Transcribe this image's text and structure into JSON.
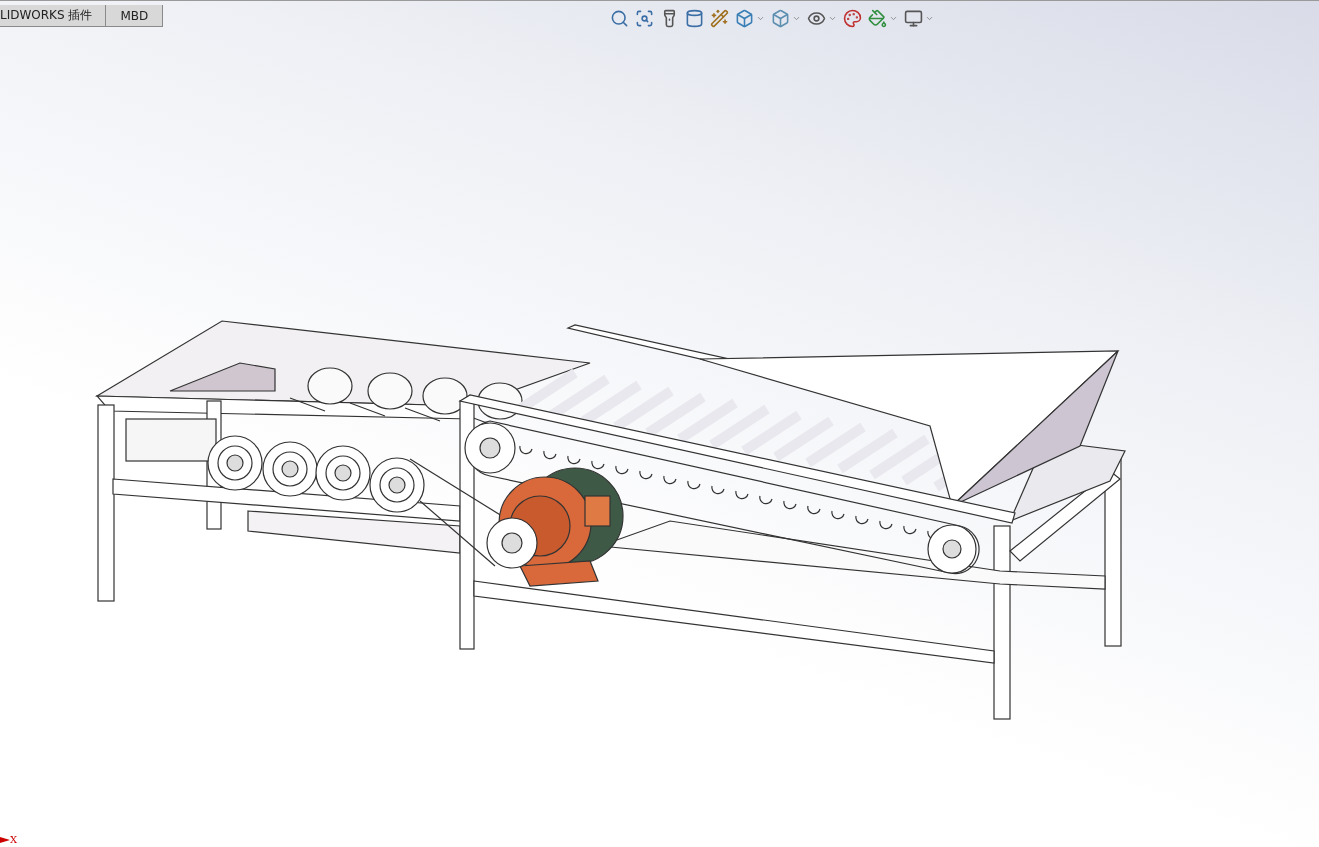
{
  "tabs": [
    {
      "label": "LIDWORKS 插件",
      "selected": false
    },
    {
      "label": "MBD",
      "selected": false
    }
  ],
  "toolbar": [
    {
      "kind": "zoom-fit",
      "dropdown": false
    },
    {
      "kind": "zoom-area",
      "dropdown": false
    },
    {
      "kind": "previous-view",
      "dropdown": false
    },
    {
      "kind": "section",
      "dropdown": false
    },
    {
      "kind": "dynamic-annotation",
      "dropdown": false
    },
    {
      "kind": "view-orientation",
      "dropdown": true
    },
    {
      "kind": "display-style",
      "dropdown": true
    },
    {
      "kind": "hide-show",
      "dropdown": true
    },
    {
      "kind": "edit-appearance",
      "dropdown": false
    },
    {
      "kind": "scene",
      "dropdown": true
    },
    {
      "kind": "view-settings",
      "dropdown": true
    }
  ],
  "triad": {
    "axis_label": "X"
  }
}
